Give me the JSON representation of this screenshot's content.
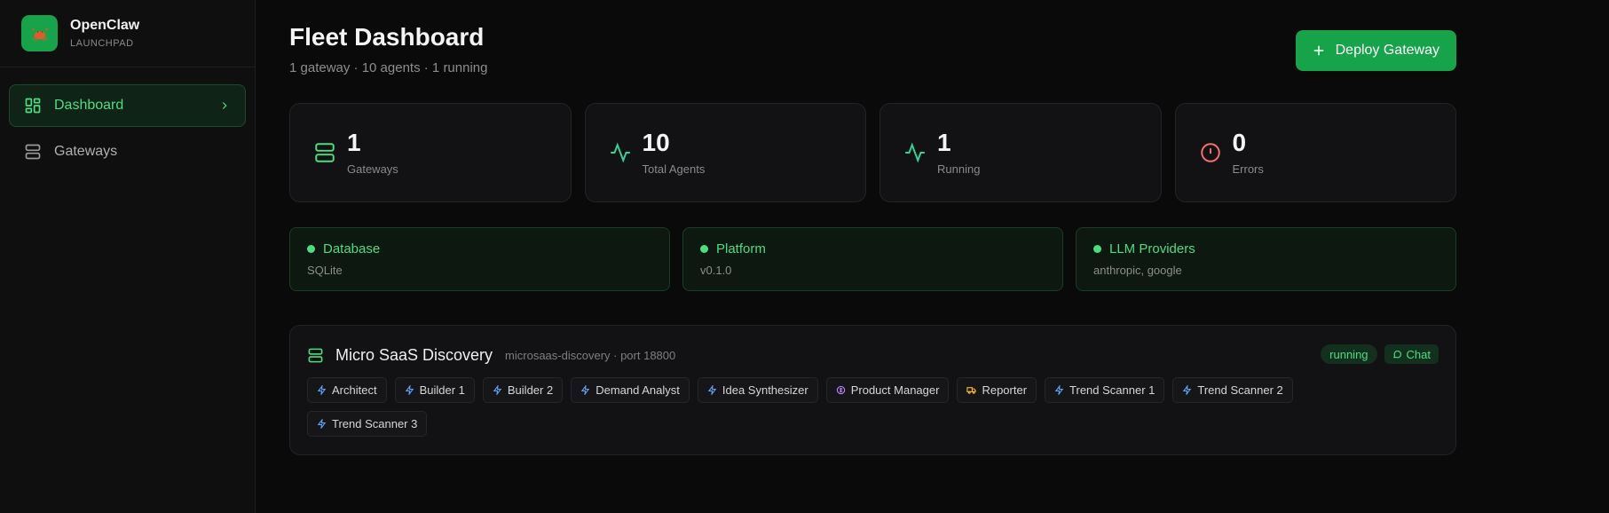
{
  "brand": {
    "name": "OpenClaw",
    "subtitle": "LAUNCHPAD"
  },
  "sidebar": {
    "items": [
      {
        "label": "Dashboard",
        "active": true
      },
      {
        "label": "Gateways",
        "active": false
      }
    ]
  },
  "header": {
    "title": "Fleet Dashboard",
    "subtitle": "1 gateway · 10 agents · 1 running",
    "deploy_label": "Deploy Gateway"
  },
  "stats": [
    {
      "value": "1",
      "label": "Gateways",
      "icon": "server-icon",
      "color": "#4ade80"
    },
    {
      "value": "10",
      "label": "Total Agents",
      "icon": "activity-icon",
      "color": "#34d399"
    },
    {
      "value": "1",
      "label": "Running",
      "icon": "activity-icon",
      "color": "#34d399"
    },
    {
      "value": "0",
      "label": "Errors",
      "icon": "alert-circle-icon",
      "color": "#f87171"
    }
  ],
  "status": [
    {
      "name": "Database",
      "detail": "SQLite"
    },
    {
      "name": "Platform",
      "detail": "v0.1.0"
    },
    {
      "name": "LLM Providers",
      "detail": "anthropic, google"
    }
  ],
  "gateway": {
    "name": "Micro SaaS Discovery",
    "meta": "microsaas-discovery · port 18800",
    "status": "running",
    "chat_label": "Chat",
    "agents": [
      {
        "label": "Architect",
        "icon": "zap-icon"
      },
      {
        "label": "Builder 1",
        "icon": "zap-icon"
      },
      {
        "label": "Builder 2",
        "icon": "zap-icon"
      },
      {
        "label": "Demand Analyst",
        "icon": "zap-icon"
      },
      {
        "label": "Idea Synthesizer",
        "icon": "zap-icon"
      },
      {
        "label": "Product Manager",
        "icon": "brain-icon"
      },
      {
        "label": "Reporter",
        "icon": "truck-icon"
      },
      {
        "label": "Trend Scanner 1",
        "icon": "zap-icon"
      },
      {
        "label": "Trend Scanner 2",
        "icon": "zap-icon"
      },
      {
        "label": "Trend Scanner 3",
        "icon": "zap-icon"
      }
    ]
  },
  "colors": {
    "accent": "#16a34a",
    "accent_text": "#4ade80",
    "background": "#0a0a0a"
  }
}
